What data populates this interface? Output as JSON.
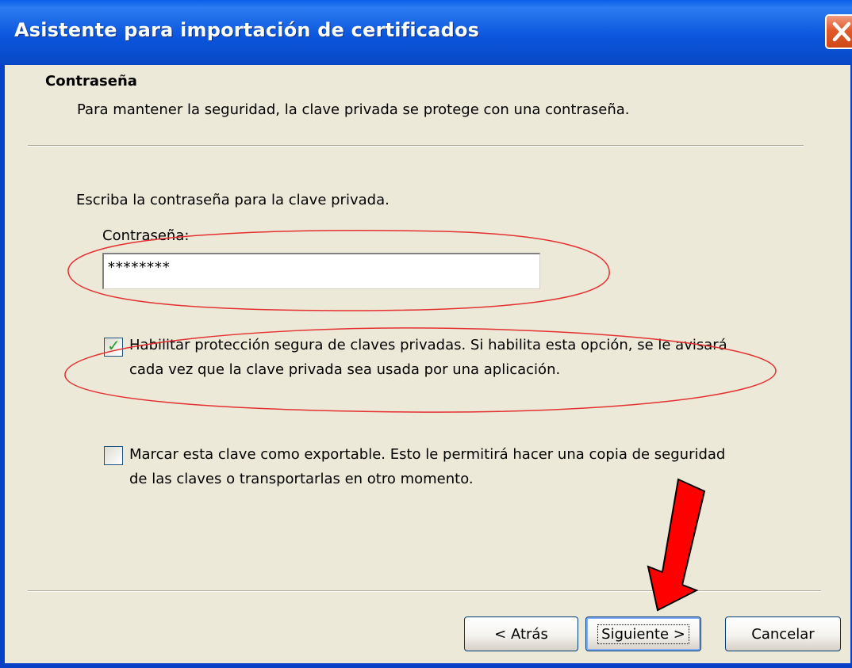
{
  "window": {
    "title": "Asistente para importación de certificados"
  },
  "header": {
    "heading": "Contraseña",
    "description": "Para mantener la seguridad, la clave privada se protege con una contraseña."
  },
  "main": {
    "prompt": "Escriba la contraseña para la clave privada.",
    "password_label": "Contraseña:",
    "password_value": "********",
    "options": [
      {
        "text": "Habilitar protección segura de claves privadas. Si habilita esta opción, se le avisará cada vez que la clave privada sea usada por una aplicación.",
        "checked": true
      },
      {
        "text": "Marcar esta clave como exportable. Esto le permitirá hacer una copia de seguridad de las claves o transportarlas en otro momento.",
        "checked": false
      }
    ]
  },
  "footer": {
    "back_label": "< Atrás",
    "next_label": "Siguiente >",
    "cancel_label": "Cancelar"
  },
  "colors": {
    "titlebar": "#0A5FE8",
    "dialog_bg": "#ECE9D8",
    "annotation_ellipse": "#E53030",
    "annotation_arrow": "#FF0000",
    "checkmark": "#21A121"
  },
  "icons": {
    "close": "close-icon",
    "check": "checkmark-icon"
  }
}
